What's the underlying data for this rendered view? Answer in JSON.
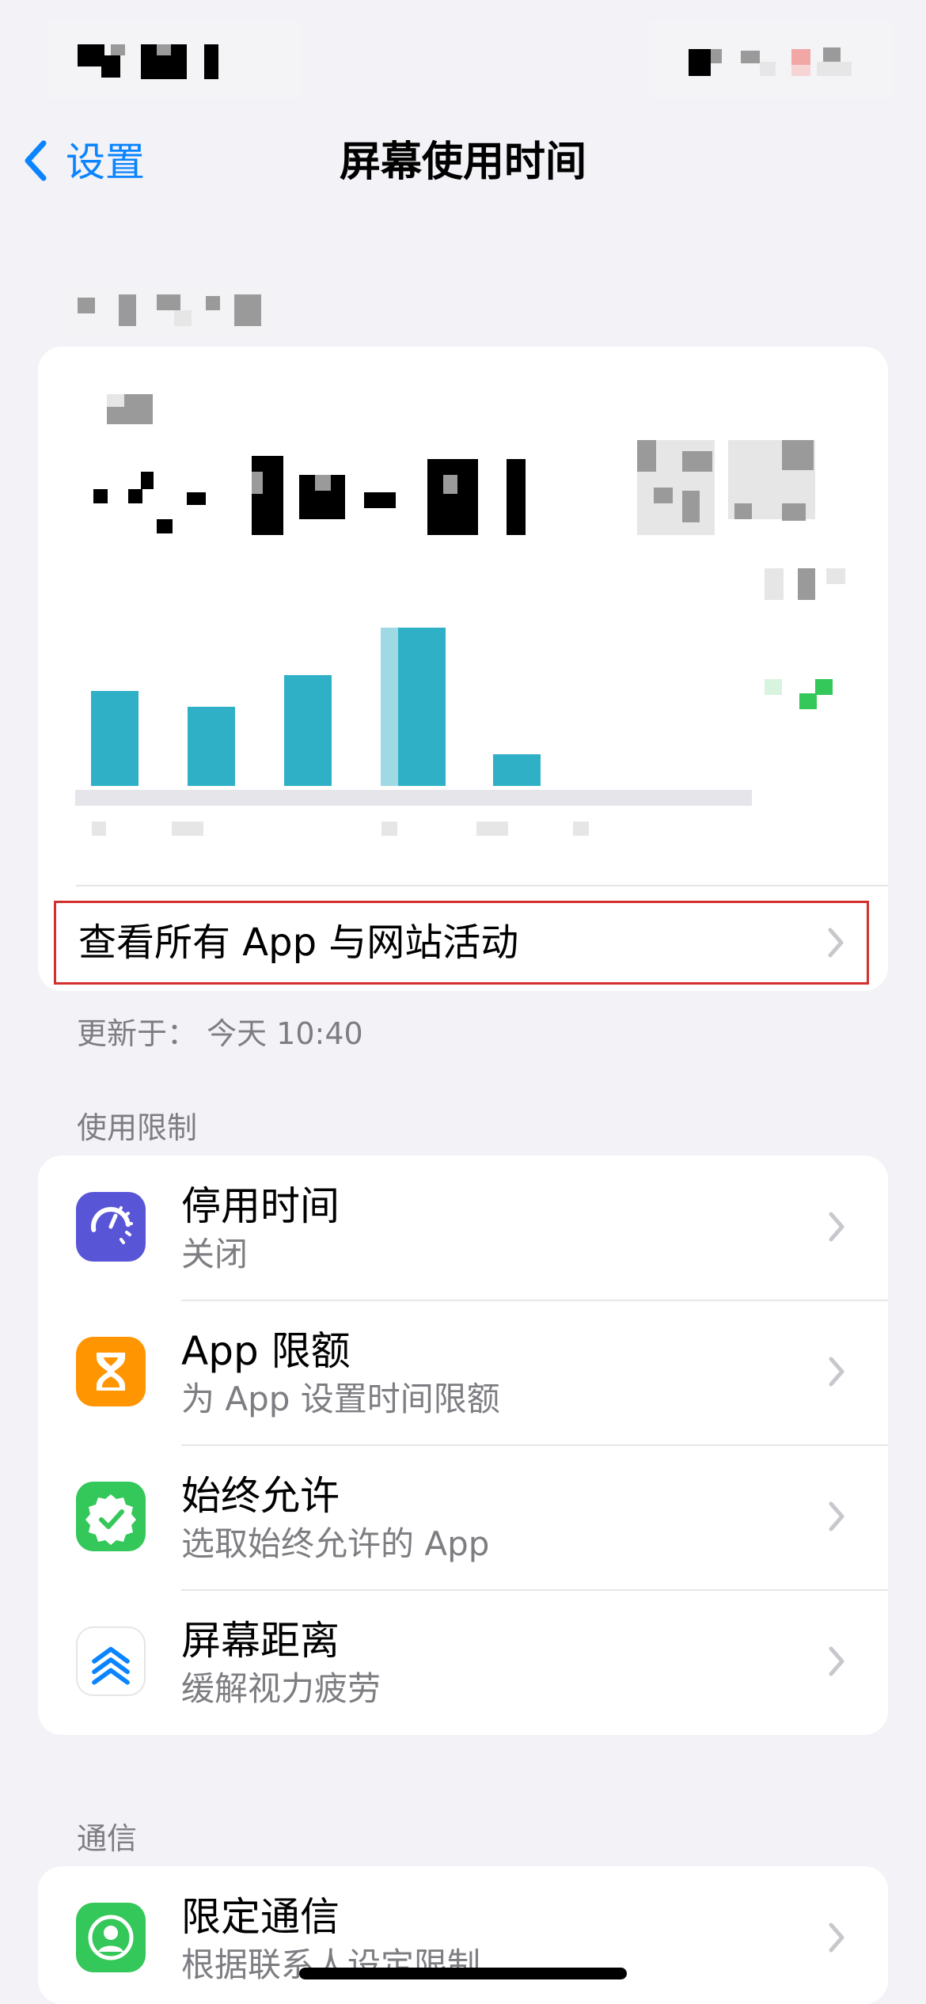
{
  "nav": {
    "back_label": "设置",
    "title": "屏幕使用时间"
  },
  "summary": {
    "activity_link": "查看所有 App 与网站活动",
    "updated": "更新于： 今天 10:40"
  },
  "sections": {
    "limits_header": "使用限制",
    "comm_header": "通信"
  },
  "limits": [
    {
      "title": "停用时间",
      "subtitle": "关闭",
      "icon": "downtime-icon",
      "color": "#5856d6"
    },
    {
      "title": "App 限额",
      "subtitle": "为 App 设置时间限额",
      "icon": "hourglass-icon",
      "color": "#ff9500"
    },
    {
      "title": "始终允许",
      "subtitle": "选取始终允许的 App",
      "icon": "checkmark-seal-icon",
      "color": "#34c759"
    },
    {
      "title": "屏幕距离",
      "subtitle": "缓解视力疲劳",
      "icon": "screen-distance-icon",
      "color": "#ffffff"
    }
  ],
  "communication": [
    {
      "title": "限定通信",
      "subtitle": "根据联系人设定限制",
      "icon": "person-circle-icon",
      "color": "#34c759"
    }
  ],
  "chart_data": {
    "type": "bar",
    "values": [
      120,
      100,
      140,
      200,
      40
    ],
    "bar_color": "#30b0c7"
  }
}
